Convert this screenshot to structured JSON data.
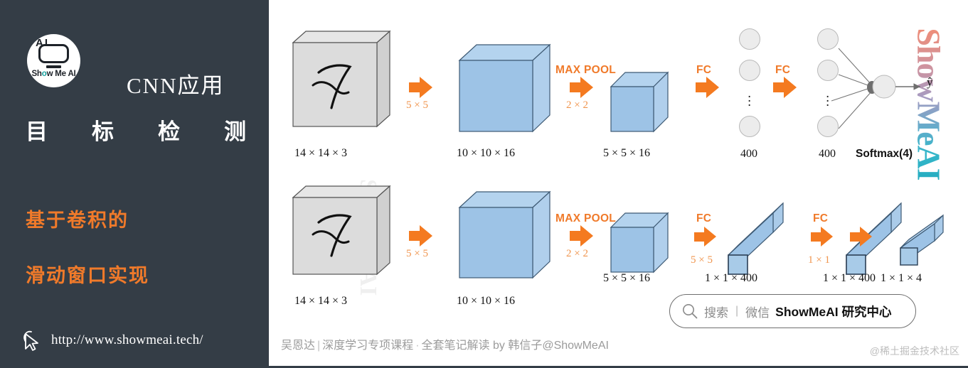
{
  "sidebar": {
    "logo": {
      "badge_text": "AI",
      "caption_pre": "Sh",
      "caption_dot": "o",
      "caption_post": "w Me AI"
    },
    "title_cnn": "CNN应用",
    "title_main_chars": [
      "目",
      "标",
      "检",
      "测"
    ],
    "subtitle_line1": "基于卷积的",
    "subtitle_line2": "滑动窗口实现",
    "url": "http://www.showmeai.tech/",
    "cursor_icon": "cursor-arrow-icon",
    "bg_color": "#343d46",
    "accent_color": "#f07a2a"
  },
  "diagram": {
    "watermark_vertical": "ShowMeAI",
    "watermark_faint": "ShowMeAI",
    "colors": {
      "orange": "#f07a2a",
      "kernel_label": "#f0954e",
      "blue_face": "#9dc3e6",
      "gray_face": "#d8d8d8"
    },
    "row_top": {
      "input_label": "14 × 14 × 3",
      "input_glyph": "handwritten-7",
      "conv_kernel": "5 × 5",
      "conv_label": "10 × 10 × 16",
      "pool_op": "MAX POOL",
      "pool_kernel": "2 × 2",
      "pool_label": "5 × 5 × 16",
      "fc1_op": "FC",
      "fc1_label": "400",
      "fc2_op": "FC",
      "fc2_label": "400",
      "softmax_label": "Softmax(4)",
      "output_symbol": "ŷ"
    },
    "row_bottom": {
      "input_label": "14 × 14 × 3",
      "input_glyph": "handwritten-7",
      "conv_kernel": "5 × 5",
      "conv_label": "10 × 10 × 16",
      "pool_op": "MAX POOL",
      "pool_kernel": "2 × 2",
      "pool_label": "5 × 5 × 16",
      "fc1_op": "FC",
      "fc1_kernel": "5 × 5",
      "fc1_label": "1 × 1 × 400",
      "fc2_op": "FC",
      "fc2_kernel": "1 × 1",
      "fc2_label": "1 × 1 × 400",
      "out_label": "1 × 1 × 4"
    }
  },
  "footer": {
    "search_icon": "magnifier-icon",
    "search_text": "搜索",
    "search_separator": "|",
    "search_channel": "微信",
    "search_account": "ShowMeAI 研究中心",
    "caption_author": "吴恩达",
    "caption_sep1": "|",
    "caption_course": "深度学习专项课程",
    "caption_dot": "·",
    "caption_notes": "全套笔记解读",
    "caption_by": "by 韩信子@ShowMeAI",
    "credit": "@稀土掘金技术社区"
  }
}
